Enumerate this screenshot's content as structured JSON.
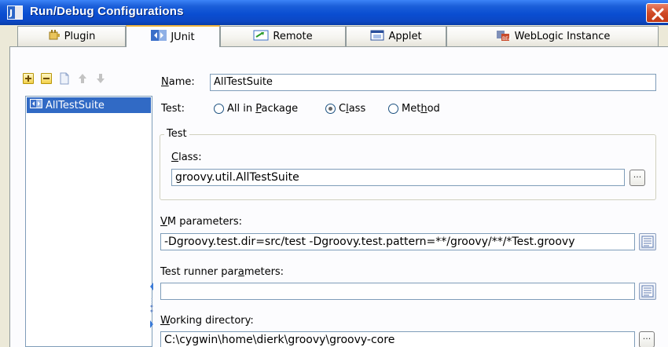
{
  "window": {
    "title": "Run/Debug Configurations",
    "close_glyph": "×",
    "accent": "#0a4ed2"
  },
  "tabs": [
    {
      "label": "Plugin",
      "icon": "plugin-icon",
      "active": false
    },
    {
      "label": "JUnit",
      "icon": "junit-icon",
      "active": true
    },
    {
      "label": "Remote",
      "icon": "remote-icon",
      "active": false
    },
    {
      "label": "Applet",
      "icon": "applet-icon",
      "active": false
    },
    {
      "label": "WebLogic Instance",
      "icon": "weblogic-icon",
      "active": false
    }
  ],
  "toolbar": {
    "buttons": [
      "add-icon",
      "remove-icon",
      "copy-icon",
      "move-up-icon",
      "move-down-icon"
    ]
  },
  "tree": {
    "items": [
      {
        "label": "AllTestSuite",
        "selected": true,
        "icon": "junit-config-icon"
      }
    ]
  },
  "form": {
    "name_label": "Name:",
    "name_value": "AllTestSuite",
    "test_label": "Test:",
    "radio_package": "All in Package",
    "radio_class": "Class",
    "radio_method": "Method",
    "selected_radio": "Class",
    "group_title": "Test",
    "class_label": "Class:",
    "class_value": "groovy.util.AllTestSuite",
    "vm_label": "VM parameters:",
    "vm_value": "-Dgroovy.test.dir=src/test -Dgroovy.test.pattern=**/groovy/**/*Test.groovy",
    "runner_label": "Test runner parameters:",
    "runner_value": "",
    "workdir_label": "Working directory:",
    "workdir_value": "C:\\cygwin\\home\\dierk\\groovy\\groovy-core",
    "browse_glyph": "..."
  }
}
